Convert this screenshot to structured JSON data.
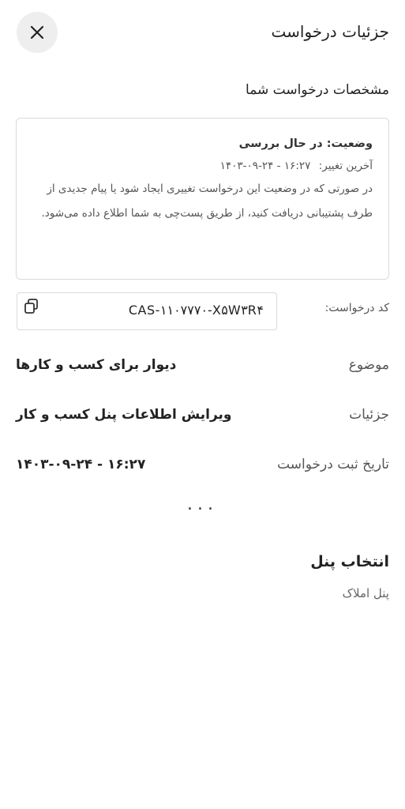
{
  "header": {
    "title": "جزئیات درخواست",
    "close_icon": "close-icon"
  },
  "section": {
    "title": "مشخصات درخواست شما"
  },
  "status": {
    "line": "وضعیت: در حال بررسی",
    "last_change_label": "آخرین تغییر:",
    "last_change_value": "۱۴۰۳-۰۹-۲۴ - ۱۶:۲۷",
    "description": "در صورتی که در وضعیت این درخواست تغییری ایجاد شود یا پیام جدیدی از طرف پشتیبانی دریافت کنید، از طریق پست‌چی به شما اطلاع داده می‌شود."
  },
  "code": {
    "label": "کد درخواست:",
    "value": "CAS-۱۱۰۷۷۷۰-X۵W۳R۴",
    "copy_icon": "copy-icon"
  },
  "details": [
    {
      "label": "موضوع",
      "value": "دیوار برای کسب و کارها"
    },
    {
      "label": "جزئیات",
      "value": "ویرایش اطلاعات پنل کسب و کار"
    },
    {
      "label": "تاریخ ثبت درخواست",
      "value": "۱۴۰۳-۰۹-۲۴ - ۱۶:۲۷"
    }
  ],
  "more": "...",
  "panel": {
    "title": "انتخاب پنل",
    "selected": "پنل املاک"
  }
}
